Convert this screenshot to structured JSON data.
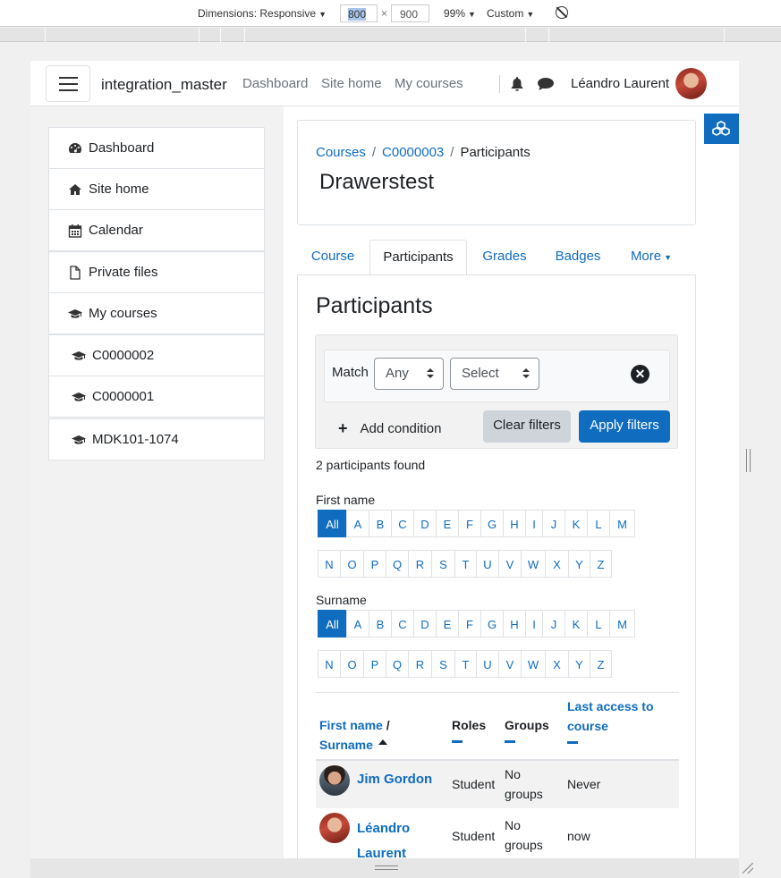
{
  "devtools": {
    "dimensions_label": "Dimensions: Responsive",
    "width": "800",
    "times": "×",
    "height": "900",
    "zoom": "99%",
    "throttle": "Custom",
    "caret": "▼"
  },
  "navbar": {
    "site_name": "integration_master",
    "links": [
      "Dashboard",
      "Site home",
      "My courses"
    ],
    "user_name": "Léandro Laurent"
  },
  "drawer": {
    "items": [
      {
        "label": "Dashboard",
        "icon": "dashboard-icon"
      },
      {
        "label": "Site home",
        "icon": "home-icon"
      },
      {
        "label": "Calendar",
        "icon": "calendar-icon"
      },
      {
        "label": "Private files",
        "icon": "file-icon"
      },
      {
        "label": "My courses",
        "icon": "graduation-cap-icon"
      },
      {
        "label": "C0000002",
        "icon": "graduation-cap-icon"
      },
      {
        "label": "C0000001",
        "icon": "graduation-cap-icon"
      },
      {
        "label": "MDK101-1074",
        "icon": "graduation-cap-icon"
      }
    ]
  },
  "breadcrumb": {
    "items": [
      "Courses",
      "C0000003",
      "Participants"
    ],
    "separator": "/"
  },
  "page_title": "Drawerstest",
  "tabs": [
    {
      "label": "Course",
      "active": false
    },
    {
      "label": "Participants",
      "active": true
    },
    {
      "label": "Grades",
      "active": false
    },
    {
      "label": "Badges",
      "active": false
    },
    {
      "label": "More",
      "active": false
    }
  ],
  "participants": {
    "heading": "Participants",
    "filter": {
      "match_label": "Match",
      "match_value": "Any",
      "select_value": "Select",
      "clear_icon": "✕",
      "add_condition": "Add condition",
      "add_icon": "+",
      "clear_filters": "Clear filters",
      "apply_filters": "Apply filters"
    },
    "found_text": "2 participants found",
    "first_name_label": "First name",
    "surname_label": "Surname",
    "initials_all": "All",
    "initials_row1": [
      "A",
      "B",
      "C",
      "D",
      "E",
      "F",
      "G",
      "H",
      "I",
      "J",
      "K",
      "L",
      "M"
    ],
    "initials_row2": [
      "N",
      "O",
      "P",
      "Q",
      "R",
      "S",
      "T",
      "U",
      "V",
      "W",
      "X",
      "Y",
      "Z"
    ],
    "table": {
      "headers": {
        "first_name": "First name",
        "slash": " /",
        "surname": "Surname",
        "roles": "Roles",
        "groups": "Groups",
        "last_access": "Last access to course"
      },
      "rows": [
        {
          "name": "Jim Gordon",
          "role": "Student",
          "groups": "No groups",
          "last_access": "Never"
        },
        {
          "name": "Léandro Laurent",
          "role": "Student",
          "groups": "No groups",
          "last_access": "now"
        }
      ]
    }
  },
  "colors": {
    "primary": "#0f6cbf",
    "text": "#1d2125",
    "muted": "#6a737b",
    "drawer_bg": "#f2f2f2"
  }
}
